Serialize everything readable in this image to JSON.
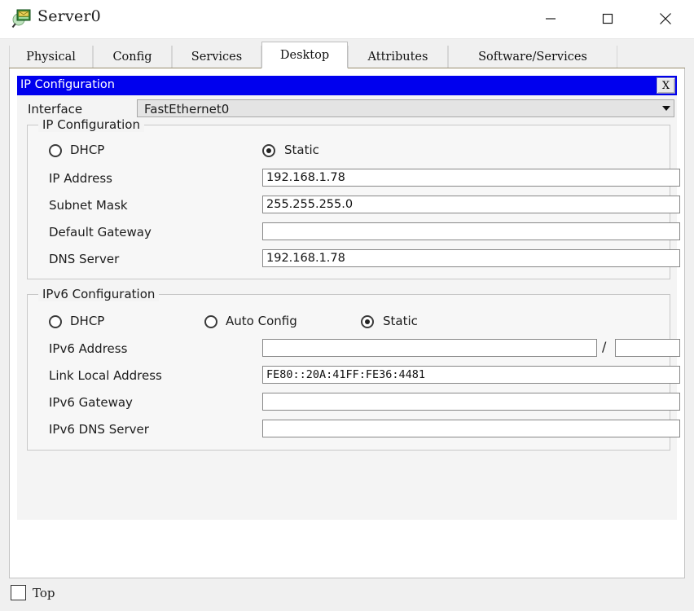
{
  "window": {
    "title": "Server0",
    "icon": "server-inspect-icon",
    "controls": {
      "minimize": "minimize-icon",
      "maximize": "maximize-icon",
      "close": "close-icon"
    }
  },
  "tabs": [
    {
      "label": "Physical",
      "active": false
    },
    {
      "label": "Config",
      "active": false
    },
    {
      "label": "Services",
      "active": false
    },
    {
      "label": "Desktop",
      "active": true
    },
    {
      "label": "Attributes",
      "active": false
    },
    {
      "label": "Software/Services",
      "active": false
    }
  ],
  "ip_config_window": {
    "title": "IP Configuration",
    "close_label": "X",
    "titlebar_color": "#0000ee",
    "interface": {
      "label": "Interface",
      "value": "FastEthernet0",
      "options": [
        "FastEthernet0"
      ]
    },
    "ipv4": {
      "group_title": "IP Configuration",
      "mode_options": [
        "DHCP",
        "Static"
      ],
      "dhcp_label": "DHCP",
      "static_label": "Static",
      "selected_mode": "Static",
      "fields": [
        {
          "label": "IP Address",
          "value": "192.168.1.78"
        },
        {
          "label": "Subnet Mask",
          "value": "255.255.255.0"
        },
        {
          "label": "Default Gateway",
          "value": ""
        },
        {
          "label": "DNS Server",
          "value": "192.168.1.78"
        }
      ]
    },
    "ipv6": {
      "group_title": "IPv6 Configuration",
      "dhcp_label": "DHCP",
      "auto_config_label": "Auto Config",
      "static_label": "Static",
      "selected_mode": "Static",
      "address_label": "IPv6 Address",
      "address_value": "",
      "prefix_separator": "/",
      "prefix_value": "",
      "fields": [
        {
          "label": "Link Local Address",
          "value": "FE80::20A:41FF:FE36:4481"
        },
        {
          "label": "IPv6 Gateway",
          "value": ""
        },
        {
          "label": "IPv6 DNS Server",
          "value": ""
        }
      ]
    }
  },
  "bottom": {
    "top_checkbox_label": "Top",
    "top_checked": false
  }
}
